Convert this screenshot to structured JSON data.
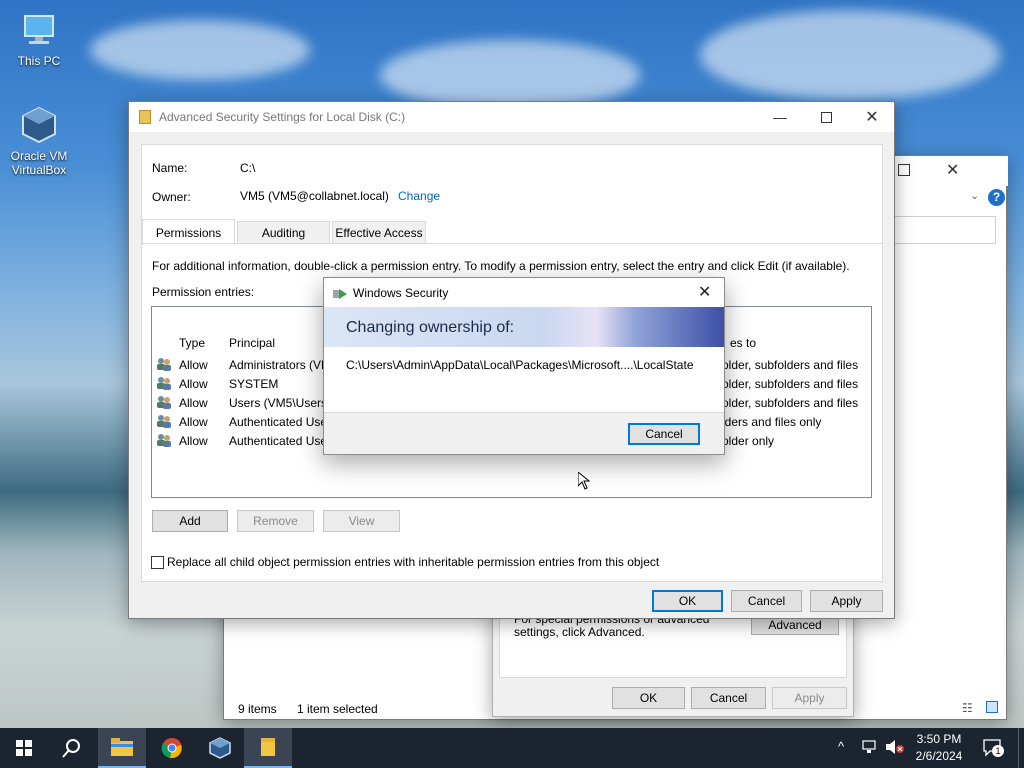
{
  "desktop": {
    "icons": [
      {
        "label": "This PC"
      },
      {
        "label": "Oracle VM VirtualBox"
      }
    ]
  },
  "back_window": {
    "status_items": "9 items",
    "status_selected": "1 item selected",
    "props_text": "For special permissions or advanced settings, click Advanced.",
    "advanced_label": "Advanced",
    "ok_label": "OK",
    "cancel_label": "Cancel",
    "apply_label": "Apply"
  },
  "adv_window": {
    "title": "Advanced Security Settings for Local Disk (C:)",
    "name_label": "Name:",
    "name_value": "C:\\",
    "owner_label": "Owner:",
    "owner_value": "VM5 (VM5@collabnet.local)",
    "change_link": "Change",
    "tabs": [
      {
        "label": "Permissions",
        "active": true
      },
      {
        "label": "Auditing",
        "active": false
      },
      {
        "label": "Effective Access",
        "active": false
      }
    ],
    "info_text": "For additional information, double-click a permission entry. To modify a permission entry, select the entry and click Edit (if available).",
    "entries_label": "Permission entries:",
    "columns": {
      "type": "Type",
      "principal": "Principal",
      "applies": "es to"
    },
    "rows": [
      {
        "type": "Allow",
        "principal": "Administrators (VM",
        "applies": "older, subfolders and files"
      },
      {
        "type": "Allow",
        "principal": "SYSTEM",
        "applies": "older, subfolders and files"
      },
      {
        "type": "Allow",
        "principal": "Users (VM5\\Users)",
        "applies": "older, subfolders and files"
      },
      {
        "type": "Allow",
        "principal": "Authenticated Use",
        "applies": "lders and files only"
      },
      {
        "type": "Allow",
        "principal": "Authenticated Use",
        "applies": "older only"
      }
    ],
    "add_label": "Add",
    "remove_label": "Remove",
    "view_label": "View",
    "replace_checkbox_label": "Replace all child object permission entries with inheritable permission entries from this object",
    "ok_label": "OK",
    "cancel_label": "Cancel",
    "apply_label": "Apply"
  },
  "security_dialog": {
    "title": "Windows Security",
    "heading": "Changing ownership of:",
    "path": "C:\\Users\\Admin\\AppData\\Local\\Packages\\Microsoft....\\LocalState",
    "cancel_label": "Cancel"
  },
  "taskbar": {
    "time": "3:50 PM",
    "date": "2/6/2024",
    "notification_count": "1"
  },
  "colors": {
    "accent": "#0078d7",
    "link": "#0066cc",
    "taskbar": "#1c2430"
  }
}
